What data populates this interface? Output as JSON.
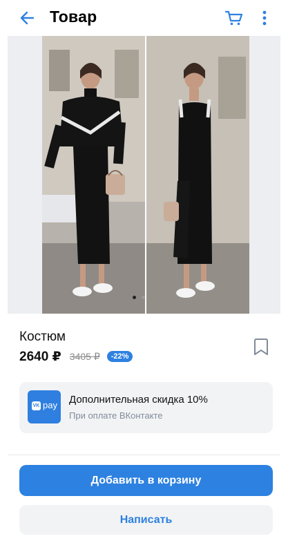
{
  "header": {
    "title": "Товар",
    "back_icon": "arrow-left-icon",
    "cart_icon": "cart-icon",
    "more_icon": "more-vertical-icon"
  },
  "gallery": {
    "image_count": 2,
    "active_index": 0,
    "description": ""
  },
  "product": {
    "name": "Костюм",
    "price": "2640 ₽",
    "old_price": "3405 ₽",
    "discount": "-22%",
    "bookmark_icon": "bookmark-icon"
  },
  "promo": {
    "logo_text": "pay",
    "logo_vk": "VK",
    "title": "Дополнительная скидка 10%",
    "subtitle": "При оплате ВКонтакте"
  },
  "actions": {
    "add_to_cart": "Добавить в корзину",
    "write": "Написать"
  },
  "colors": {
    "accent": "#2d81e0",
    "secondary_bg": "#f2f3f5",
    "muted_text": "#818c99"
  }
}
